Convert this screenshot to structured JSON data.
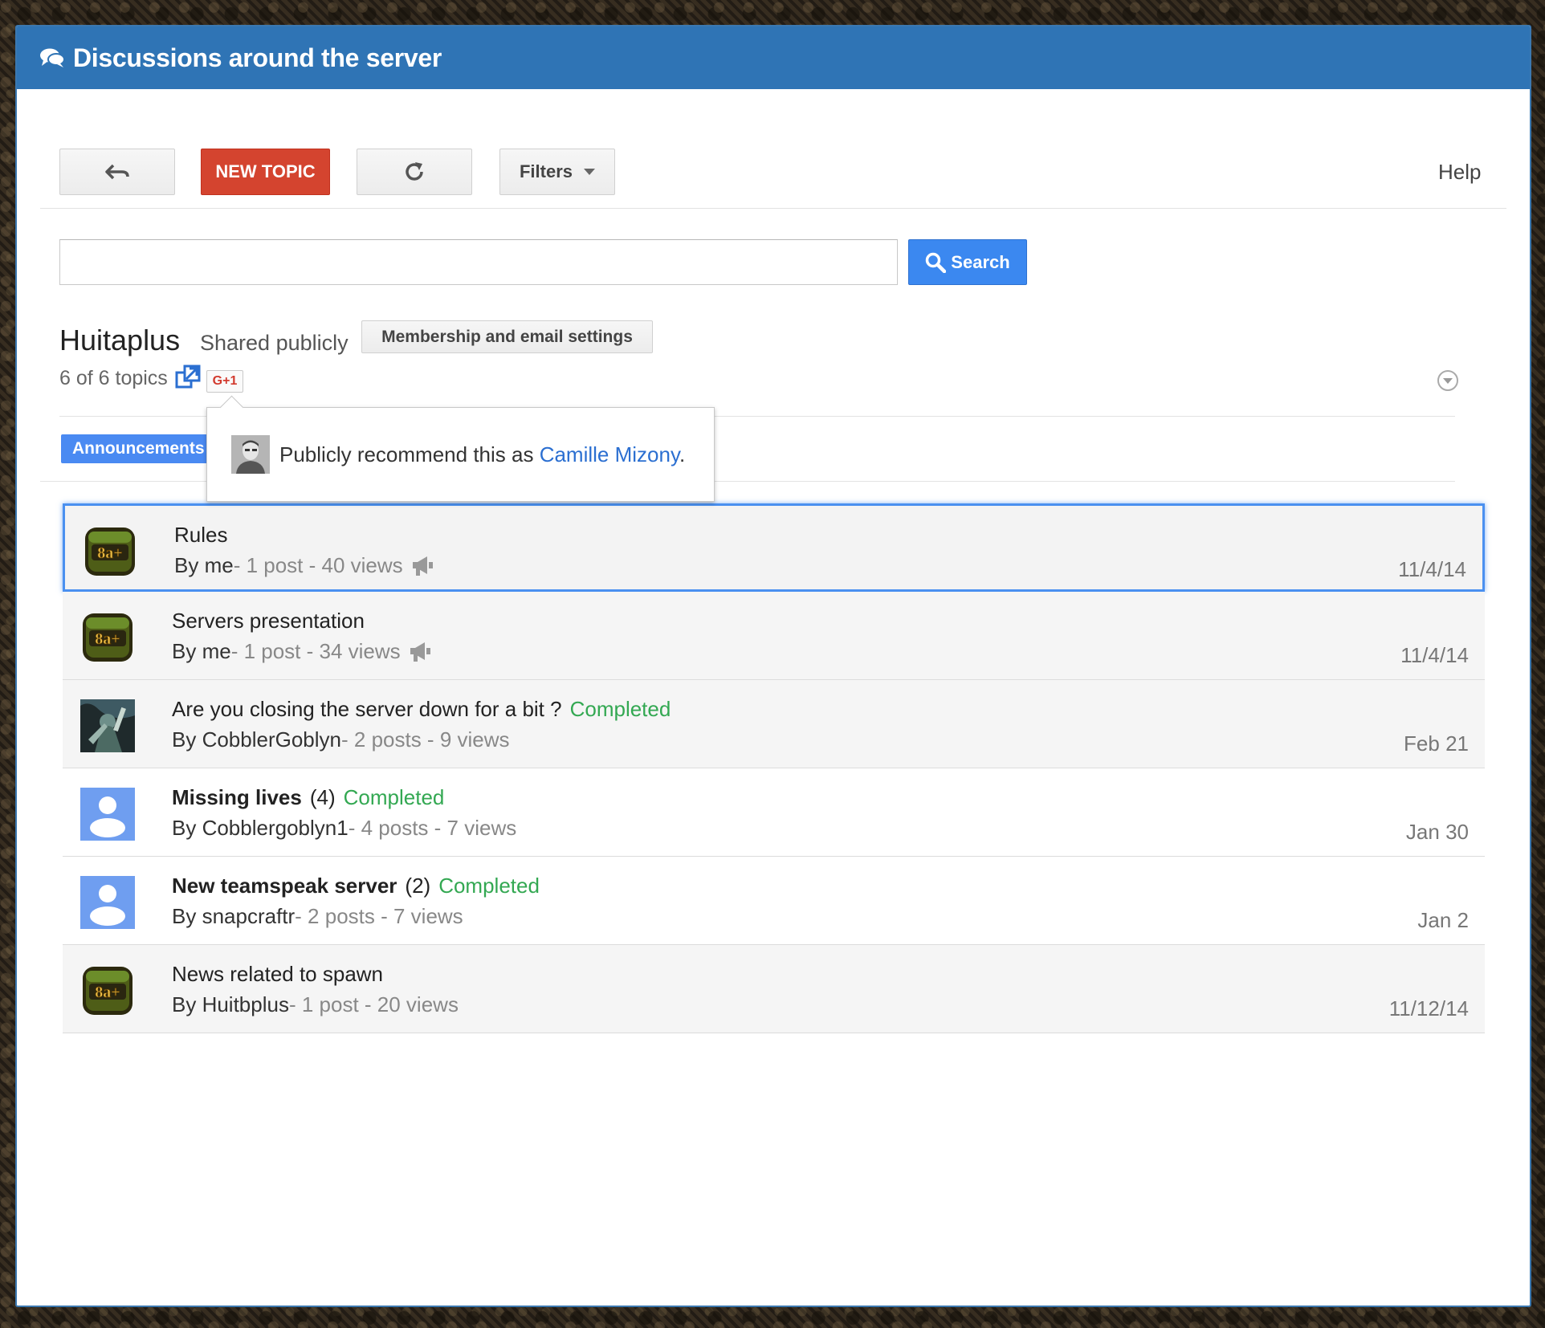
{
  "header": {
    "title": "Discussions around the server",
    "icon": "chat-bubbles-icon"
  },
  "toolbar": {
    "back_icon": "back-arrow-icon",
    "new_topic_label": "NEW TOPIC",
    "refresh_icon": "refresh-icon",
    "filters_label": "Filters",
    "help_label": "Help"
  },
  "search": {
    "value": "",
    "button_label": "Search",
    "icon": "search-icon"
  },
  "group": {
    "name": "Huitaplus",
    "visibility": "Shared publicly",
    "membership_button": "Membership and email settings",
    "topic_count": "6 of 6 topics",
    "gplus_label": "G+1",
    "tag_label": "Announcements"
  },
  "popup": {
    "text_prefix": "Publicly recommend this as ",
    "user_name": "Camille Mizony",
    "text_suffix": "."
  },
  "topics": [
    {
      "title": "Rules",
      "bold": false,
      "count": "",
      "status": "",
      "author": "By me",
      "stats": " - 1 post - 40 views",
      "announcement": true,
      "date": "11/4/14",
      "avatar": "server-logo"
    },
    {
      "title": "Servers presentation",
      "bold": false,
      "count": "",
      "status": "",
      "author": "By me",
      "stats": " - 1 post - 34 views",
      "announcement": true,
      "date": "11/4/14",
      "avatar": "server-logo"
    },
    {
      "title": "Are you closing the server down for a bit ?",
      "bold": false,
      "count": "",
      "status": "Completed",
      "author": "By CobblerGoblyn",
      "stats": " - 2 posts - 9 views",
      "announcement": false,
      "date": "Feb 21",
      "avatar": "game-art"
    },
    {
      "title": "Missing lives",
      "bold": true,
      "count": "(4)",
      "status": "Completed",
      "author": "By Cobblergoblyn1",
      "stats": " - 4 posts - 7 views",
      "announcement": false,
      "date": "Jan 30",
      "avatar": "default-user"
    },
    {
      "title": "New teamspeak server",
      "bold": true,
      "count": "(2)",
      "status": "Completed",
      "author": "By snapcraftr",
      "stats": " - 2 posts - 7 views",
      "announcement": false,
      "date": "Jan 2",
      "avatar": "default-user"
    },
    {
      "title": "News related to spawn",
      "bold": false,
      "count": "",
      "status": "",
      "author": "By Huitbplus",
      "stats": " - 1 post - 20 views",
      "announcement": false,
      "date": "11/12/14",
      "avatar": "server-logo"
    }
  ],
  "colors": {
    "header": "#2f74b5",
    "new_topic": "#d4442f",
    "search": "#3b88f0",
    "completed": "#33a852",
    "link": "#2b6fd1"
  }
}
